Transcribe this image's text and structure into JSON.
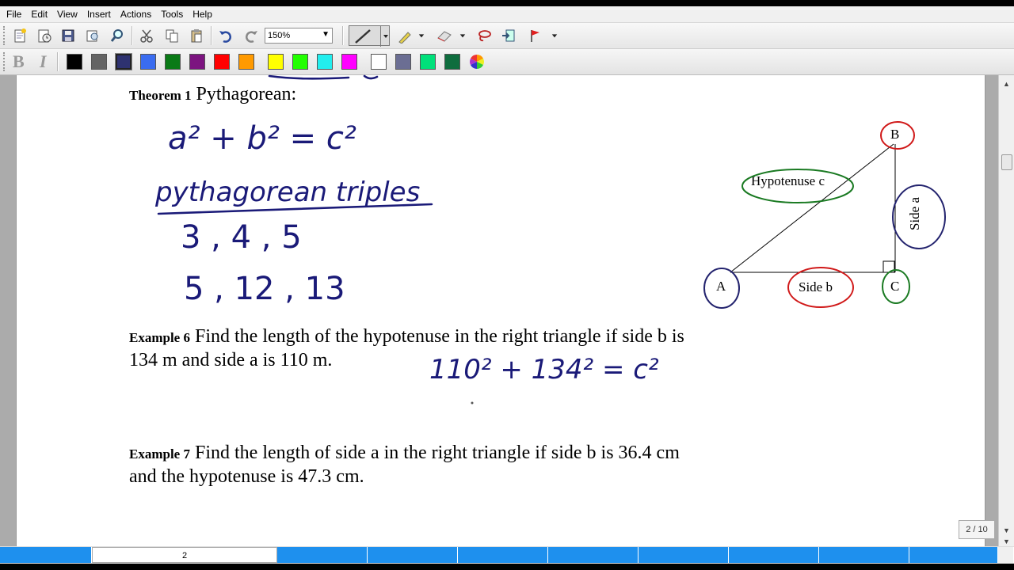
{
  "menu": {
    "items": [
      "File",
      "Edit",
      "View",
      "Insert",
      "Actions",
      "Tools",
      "Help"
    ]
  },
  "toolbar": {
    "zoom_value": "150%"
  },
  "format": {
    "bold_label": "B",
    "italic_label": "I"
  },
  "palette": [
    "#000000",
    "#646464",
    "#2e3270",
    "#3a6cf0",
    "#0a7a16",
    "#7c1480",
    "#ff0000",
    "#ff9a00",
    "#ffff00",
    "#22ff00",
    "#22eeee",
    "#ff00ff",
    "#ffffff",
    "#6b6e93",
    "#00e07a",
    "#0f6d3e"
  ],
  "theorem": {
    "label": "Theorem 1",
    "title": "Pythagorean:"
  },
  "handwriting": {
    "formula": "a² + b² = c²",
    "heading": "pythagorean triples",
    "triple1": "3 , 4 , 5",
    "triple2": "5 , 12 , 13",
    "example6_work": "110² + 134² = c²"
  },
  "diagram": {
    "vertex_a": "A",
    "vertex_b": "B",
    "vertex_c": "C",
    "hypotenuse": "Hypotenuse c",
    "side_a": "Side a",
    "side_b": "Side b"
  },
  "example6": {
    "label": "Example 6",
    "line1": "Find the length of the hypotenuse in the right triangle if side b is",
    "line2": "134 m and side a is 110 m."
  },
  "example7": {
    "label": "Example 7",
    "line1": "Find the length of side a in the right triangle if side b is 36.4 cm",
    "line2": "and the hypotenuse is 47.3 cm."
  },
  "status": {
    "page_indicator": "2 / 10"
  },
  "page_tabs": {
    "active_label": "2"
  }
}
